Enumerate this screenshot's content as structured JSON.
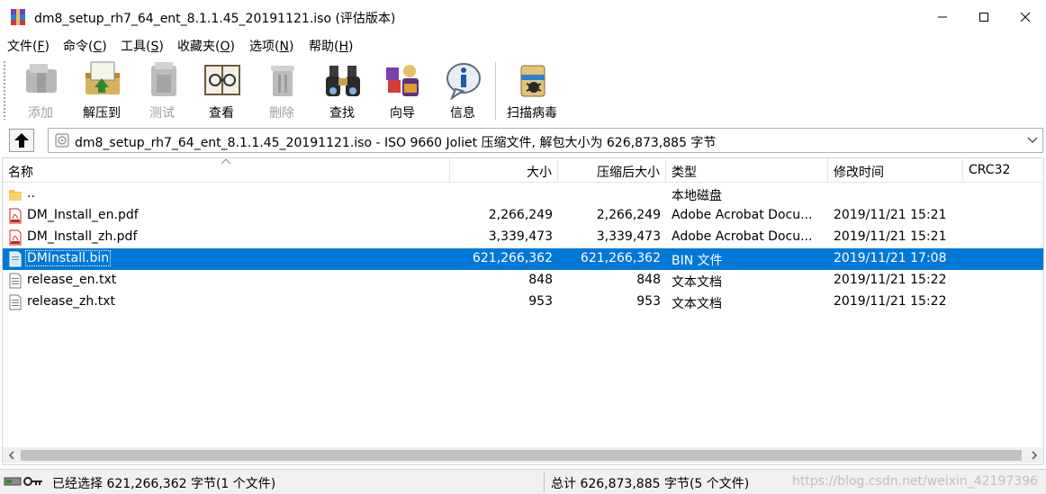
{
  "window": {
    "title": "dm8_setup_rh7_64_ent_8.1.1.45_20191121.iso (评估版本)"
  },
  "menu": [
    {
      "label": "文件(",
      "key": "F",
      "end": ")"
    },
    {
      "label": "命令(",
      "key": "C",
      "end": ")"
    },
    {
      "label": "工具(",
      "key": "S",
      "end": ")"
    },
    {
      "label": "收藏夹(",
      "key": "O",
      "end": ")"
    },
    {
      "label": "选项(",
      "key": "N",
      "end": ")"
    },
    {
      "label": "帮助(",
      "key": "H",
      "end": ")"
    }
  ],
  "toolbar": {
    "add": "添加",
    "extract": "解压到",
    "test": "测试",
    "view": "查看",
    "delete": "删除",
    "find": "查找",
    "wizard": "向导",
    "info": "信息",
    "virus": "扫描病毒"
  },
  "address": {
    "text": "dm8_setup_rh7_64_ent_8.1.1.45_20191121.iso - ISO 9660 Joliet 压缩文件, 解包大小为 626,873,885 字节"
  },
  "columns": {
    "name": "名称",
    "size": "大小",
    "packed": "压缩后大小",
    "type": "类型",
    "modified": "修改时间",
    "crc": "CRC32"
  },
  "files": [
    {
      "name": "..",
      "size": "",
      "packed": "",
      "type": "本地磁盘",
      "modified": "",
      "icon": "folder-icon"
    },
    {
      "name": "DM_Install_en.pdf",
      "size": "2,266,249",
      "packed": "2,266,249",
      "type": "Adobe Acrobat Docu...",
      "modified": "2019/11/21 15:21",
      "icon": "pdf-file-icon"
    },
    {
      "name": "DM_Install_zh.pdf",
      "size": "3,339,473",
      "packed": "3,339,473",
      "type": "Adobe Acrobat Docu...",
      "modified": "2019/11/21 15:21",
      "icon": "pdf-file-icon"
    },
    {
      "name": "DMInstall.bin",
      "size": "621,266,362",
      "packed": "621,266,362",
      "type": "BIN 文件",
      "modified": "2019/11/21 17:08",
      "icon": "bin-file-icon",
      "selected": true
    },
    {
      "name": "release_en.txt",
      "size": "848",
      "packed": "848",
      "type": "文本文档",
      "modified": "2019/11/21 15:22",
      "icon": "text-file-icon"
    },
    {
      "name": "release_zh.txt",
      "size": "953",
      "packed": "953",
      "type": "文本文档",
      "modified": "2019/11/21 15:22",
      "icon": "text-file-icon"
    }
  ],
  "status": {
    "left": "已经选择 621,266,362 字节(1 个文件)",
    "right": "总计 626,873,885 字节(5 个文件)",
    "watermark": "https://blog.csdn.net/weixin_42197396"
  },
  "colors": {
    "selection": "#0078d7",
    "disabled_text": "#a0a0a0"
  }
}
